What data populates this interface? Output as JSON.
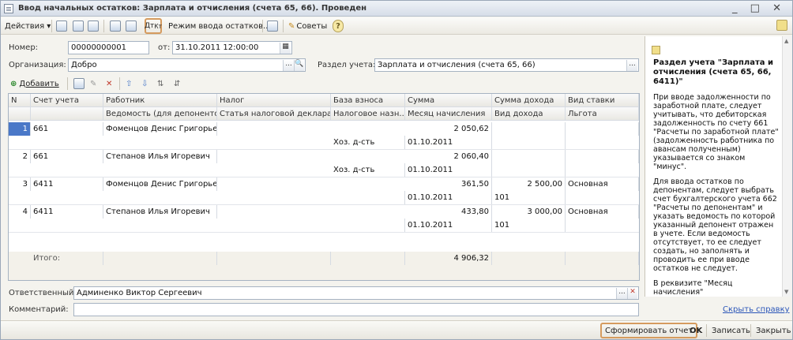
{
  "window": {
    "title": "Ввод начальных остатков: Зарплата и отчисления (счета 65, 66). Проведен",
    "controls": "_ □ ✕"
  },
  "toolbar": {
    "actions": "Действия",
    "mode": "Режим ввода остатков...",
    "tips": "Советы"
  },
  "header": {
    "number_label": "Номер:",
    "number": "00000000001",
    "from_label": "от:",
    "date": "31.10.2011 12:00:00",
    "org_label": "Организация:",
    "org": "Добро",
    "section_label": "Раздел учета:",
    "section": "Зарплата и отчисления (счета 65, 66)"
  },
  "grid_toolbar": {
    "add": "Добавить"
  },
  "grid": {
    "headers1": [
      "N",
      "Счет учета",
      "Работник",
      "Налог",
      "База взноса",
      "Сумма",
      "Сумма дохода",
      "Вид ставки"
    ],
    "headers2": [
      "",
      "",
      "Ведомость (для депонентов)",
      "Статья налоговой декларации",
      "Налоговое назн...",
      "Месяц начисления",
      "Вид дохода",
      "Льгота"
    ],
    "rows": [
      {
        "n": "1",
        "account": "661",
        "employee": "Фоменцов Денис Григорье...",
        "sum": "2 050,62",
        "base": "Хоз. д-сть",
        "month": "01.10.2011",
        "income": "",
        "income_type": "",
        "rate": ""
      },
      {
        "n": "2",
        "account": "661",
        "employee": "Степанов Илья Игоревич",
        "sum": "2 060,40",
        "base": "Хоз. д-сть",
        "month": "01.10.2011",
        "income": "",
        "income_type": "",
        "rate": ""
      },
      {
        "n": "3",
        "account": "6411",
        "employee": "Фоменцов Денис Григорье...",
        "sum": "361,50",
        "base": "",
        "month": "01.10.2011",
        "income": "2 500,00",
        "income_type": "101",
        "rate": "Основная"
      },
      {
        "n": "4",
        "account": "6411",
        "employee": "Степанов Илья Игоревич",
        "sum": "433,80",
        "base": "",
        "month": "01.10.2011",
        "income": "3 000,00",
        "income_type": "101",
        "rate": "Основная"
      }
    ],
    "total_label": "Итого:",
    "total_sum": "4 906,32"
  },
  "footer": {
    "resp_label": "Ответственный:",
    "resp": "Админенко Виктор Сергеевич",
    "comment_label": "Комментарий:",
    "comment": ""
  },
  "help": {
    "title": "Раздел учета \"Зарплата и отчисления (счета 65, 66, 6411)\"",
    "p1": "При вводе задолженности по заработной плате, следует учитывать, что дебиторская задолженность по счету 661 \"Расчеты по заработной плате\" (задолженность работника по авансам полученным) указывается со знаком \"минус\".",
    "p2": "Для ввода остатков по депонентам, следует выбрать счет бухгалтерского учета 662 \"Расчеты по депонентам\" и указать ведомость по которой указанный депонент отражен в учете. Если ведомость отсутствует, то ее следует создать, но заполнять и проводить ее при вводе остатков не следует.",
    "p3": "В реквизите \"Месяц начисления\"",
    "hide": "Скрыть справку"
  },
  "buttons": {
    "report": "Сформировать отчет",
    "ok": "OK",
    "save": "Записать",
    "close": "Закрыть"
  }
}
